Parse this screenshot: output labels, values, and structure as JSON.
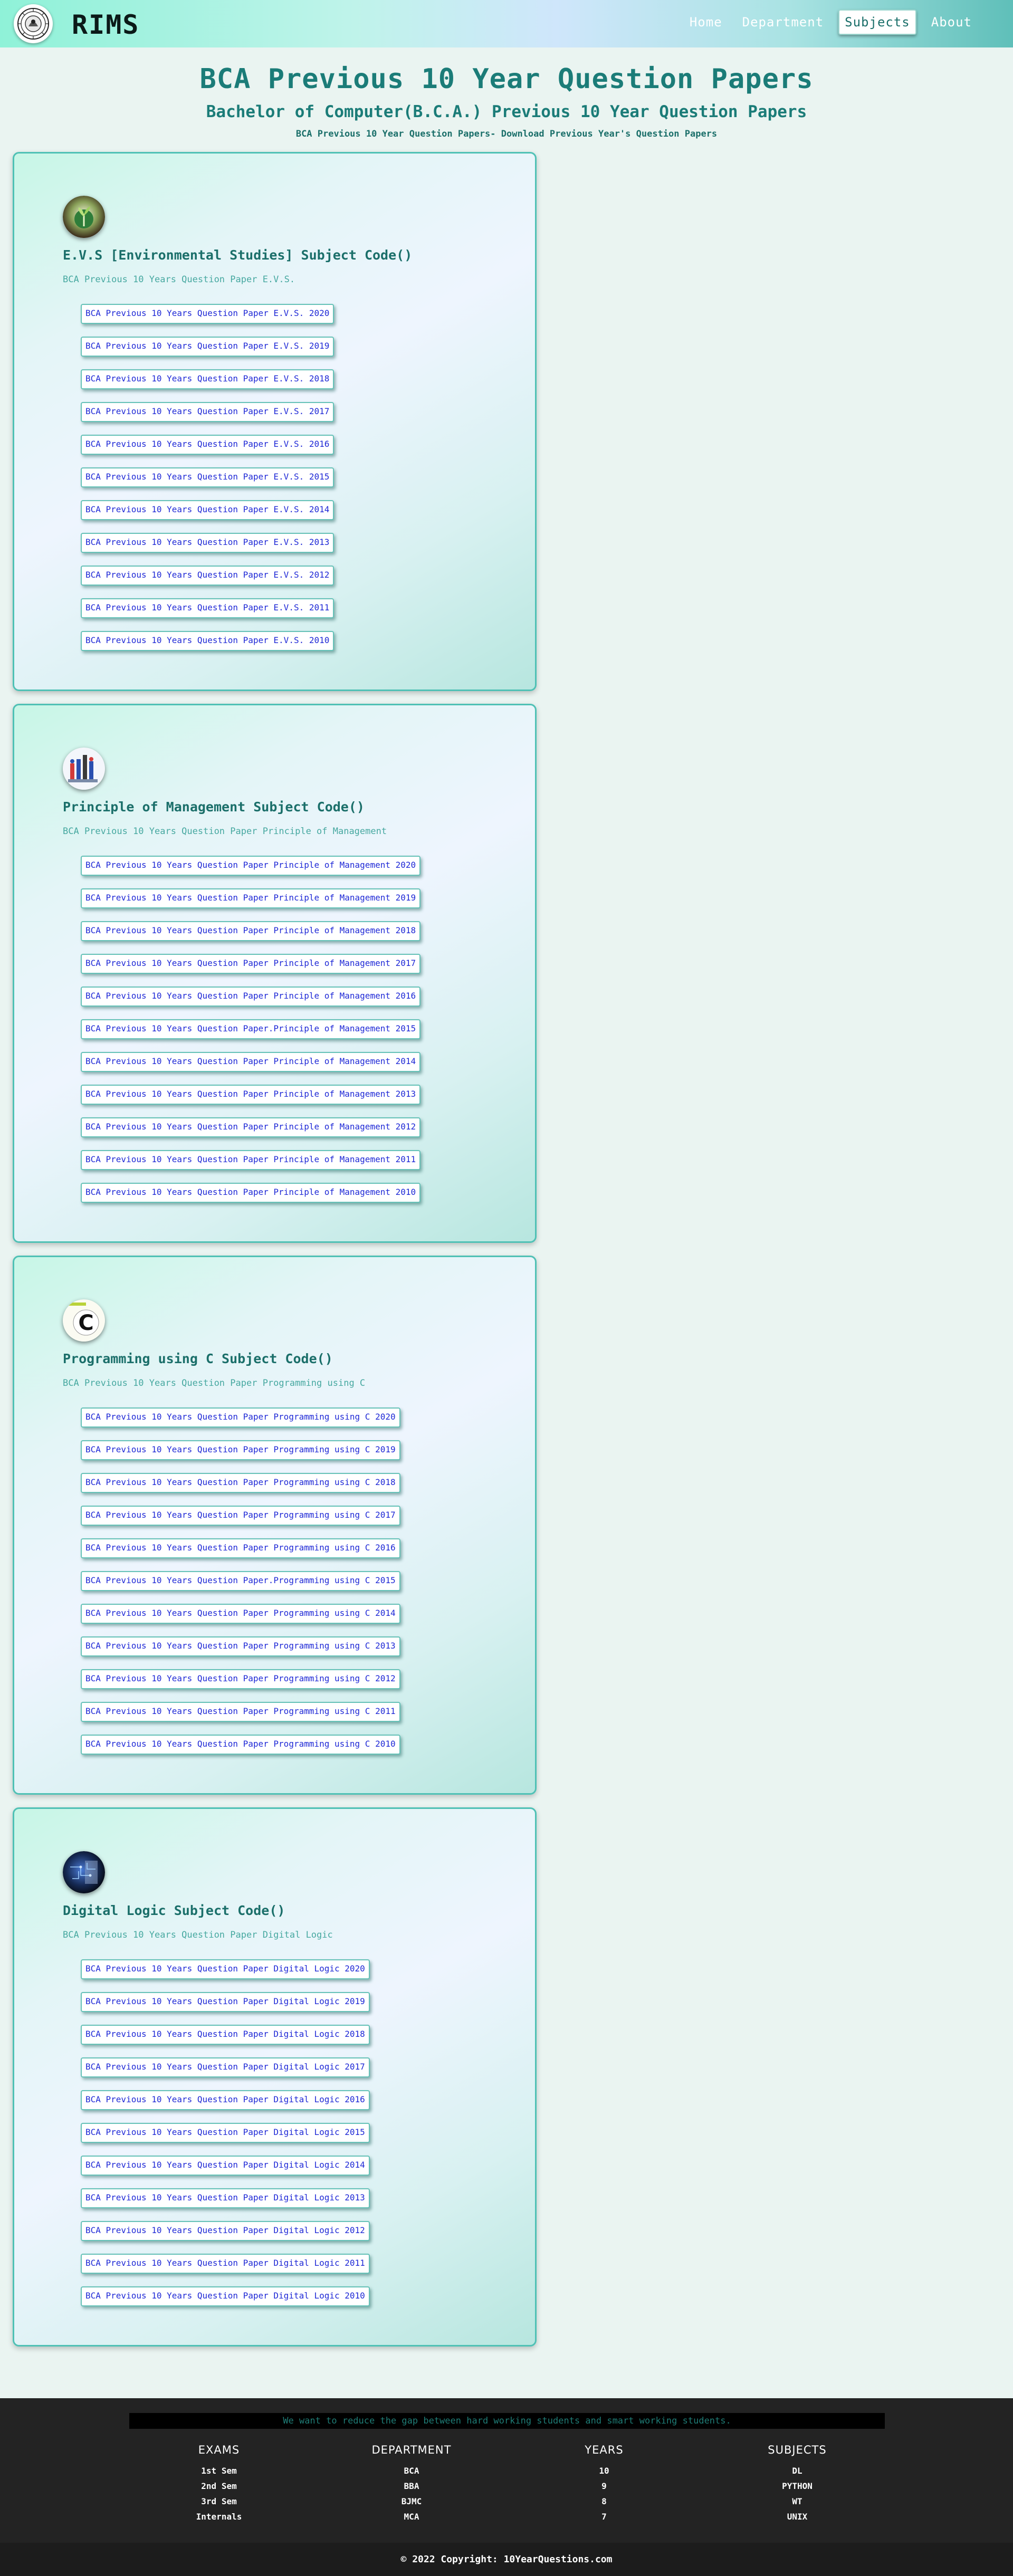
{
  "brand": {
    "name": "RIMS",
    "logo_icon": "emblem-seal-icon"
  },
  "nav": {
    "items": [
      {
        "label": "Home",
        "active": false
      },
      {
        "label": "Department",
        "active": false
      },
      {
        "label": "Subjects",
        "active": true
      },
      {
        "label": "About",
        "active": false
      }
    ]
  },
  "header": {
    "title": "BCA Previous 10 Year Question Papers",
    "subtitle": "Bachelor of Computer(B.C.A.) Previous 10 Year Question Papers",
    "note": "BCA Previous 10 Year Question Papers- Download Previous Year's Question Papers"
  },
  "subjects": [
    {
      "icon": "plant-globe-icon",
      "title": "E.V.S [Environmental Studies] Subject Code()",
      "desc": "BCA Previous 10 Years Question Paper E.V.S.",
      "links": [
        "BCA Previous 10 Years Question Paper E.V.S. 2020",
        "BCA Previous 10 Years Question Paper E.V.S. 2019",
        "BCA Previous 10 Years Question Paper E.V.S. 2018",
        "BCA Previous 10 Years Question Paper E.V.S. 2017",
        "BCA Previous 10 Years Question Paper E.V.S. 2016",
        "BCA Previous 10 Years Question Paper E.V.S. 2015",
        "BCA Previous 10 Years Question Paper E.V.S. 2014",
        "BCA Previous 10 Years Question Paper E.V.S. 2013",
        "BCA Previous 10 Years Question Paper E.V.S. 2012",
        "BCA Previous 10 Years Question Paper E.V.S. 2011",
        "BCA Previous 10 Years Question Paper E.V.S. 2010"
      ]
    },
    {
      "icon": "management-figures-icon",
      "title": "Principle of Management Subject Code()",
      "desc": "BCA Previous 10 Years Question Paper Principle of Management",
      "links": [
        "BCA Previous 10 Years Question Paper Principle of Management 2020",
        "BCA Previous 10 Years Question Paper Principle of Management 2019",
        "BCA Previous 10 Years Question Paper Principle of Management 2018",
        "BCA Previous 10 Years Question Paper Principle of Management 2017",
        "BCA Previous 10 Years Question Paper Principle of Management 2016",
        "BCA Previous 10 Years Question Paper.Principle of Management 2015",
        "BCA Previous 10 Years Question Paper Principle of Management 2014",
        "BCA Previous 10 Years Question Paper Principle of Management 2013",
        "BCA Previous 10 Years Question Paper Principle of Management 2012",
        "BCA Previous 10 Years Question Paper Principle of Management 2011",
        "BCA Previous 10 Years Question Paper Principle of Management 2010"
      ]
    },
    {
      "icon": "c-language-icon",
      "title": "Programming using C Subject Code()",
      "desc": "BCA Previous 10 Years Question Paper Programming using C",
      "links": [
        "BCA Previous 10 Years Question Paper Programming using C 2020",
        "BCA Previous 10 Years Question Paper Programming using C 2019",
        "BCA Previous 10 Years Question Paper Programming using C 2018",
        "BCA Previous 10 Years Question Paper Programming using C 2017",
        "BCA Previous 10 Years Question Paper Programming using C 2016",
        "BCA Previous 10 Years Question Paper.Programming using C 2015",
        "BCA Previous 10 Years Question Paper Programming using C 2014",
        "BCA Previous 10 Years Question Paper Programming using C 2013",
        "BCA Previous 10 Years Question Paper Programming using C 2012",
        "BCA Previous 10 Years Question Paper Programming using C 2011",
        "BCA Previous 10 Years Question Paper Programming using C 2010"
      ]
    },
    {
      "icon": "circuit-chip-icon",
      "title": "Digital Logic Subject Code()",
      "desc": "BCA Previous 10 Years Question Paper Digital Logic",
      "links": [
        "BCA Previous 10 Years Question Paper Digital Logic 2020",
        "BCA Previous 10 Years Question Paper Digital Logic 2019",
        "BCA Previous 10 Years Question Paper Digital Logic 2018",
        "BCA Previous 10 Years Question Paper Digital Logic 2017",
        "BCA Previous 10 Years Question Paper Digital Logic 2016",
        "BCA Previous 10 Years Question Paper Digital Logic 2015",
        "BCA Previous 10 Years Question Paper Digital Logic 2014",
        "BCA Previous 10 Years Question Paper Digital Logic 2013",
        "BCA Previous 10 Years Question Paper Digital Logic 2012",
        "BCA Previous 10 Years Question Paper Digital Logic 2011",
        "BCA Previous 10 Years Question Paper Digital Logic 2010"
      ]
    }
  ],
  "footer": {
    "mission": "We want to reduce the gap between hard working students and smart working students.",
    "columns": [
      {
        "title": "EXAMS",
        "items": [
          "1st Sem",
          "2nd Sem",
          "3rd Sem",
          "Internals"
        ]
      },
      {
        "title": "DEPARTMENT",
        "items": [
          "BCA",
          "BBA",
          "BJMC",
          "MCA"
        ]
      },
      {
        "title": "YEARS",
        "items": [
          "10",
          "9",
          "8",
          "7"
        ]
      },
      {
        "title": "SUBJECTS",
        "items": [
          "DL",
          "PYTHON",
          "WT",
          "UNIX"
        ]
      }
    ],
    "copyright": "© 2022 Copyright: 10YearQuestions.com"
  },
  "colors": {
    "accent": "#1b7c78",
    "link": "#1e28d6",
    "card_border": "#4fc1b5",
    "footer_bg": "#232323"
  }
}
